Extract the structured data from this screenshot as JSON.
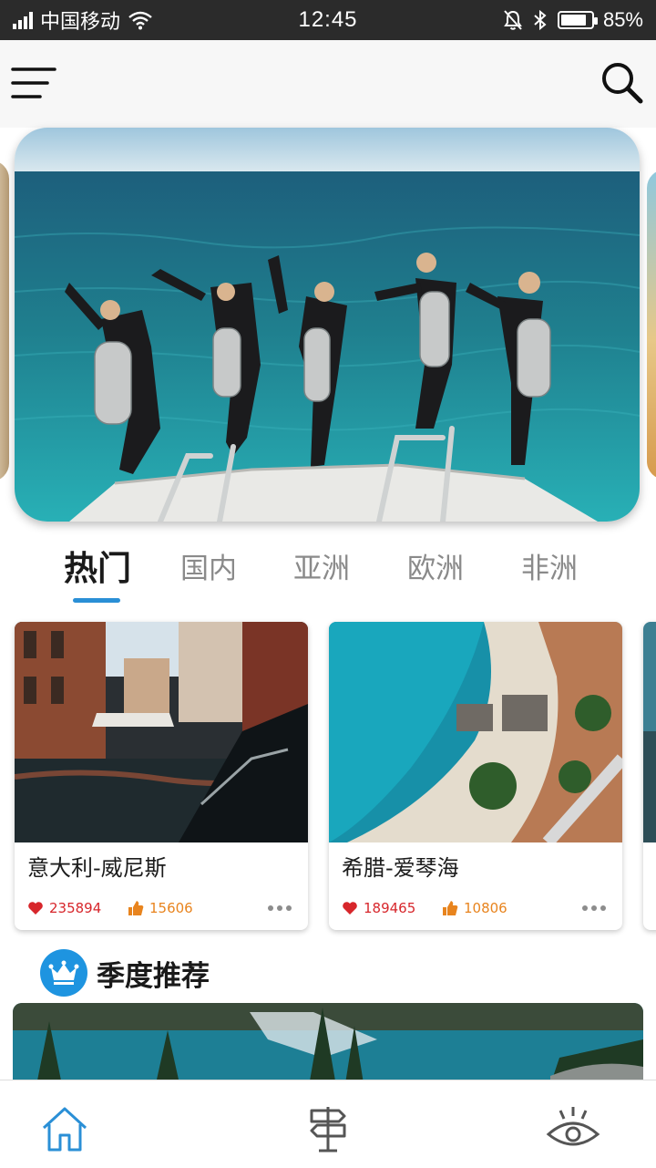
{
  "status_bar": {
    "carrier": "中国移动",
    "time": "12:45",
    "battery_percent": "85%",
    "battery_level": 0.85,
    "icons": [
      "signal-icon",
      "wifi-icon",
      "mute-bell-icon",
      "bluetooth-icon",
      "battery-icon"
    ]
  },
  "header": {
    "menu_icon": "hamburger-menu-icon",
    "search_icon": "search-icon"
  },
  "hero": {
    "image": "scuba-divers-jumping-into-sea-photo"
  },
  "tabs": [
    {
      "label": "热门",
      "active": true
    },
    {
      "label": "国内",
      "active": false
    },
    {
      "label": "亚洲",
      "active": false
    },
    {
      "label": "欧洲",
      "active": false
    },
    {
      "label": "非洲",
      "active": false
    }
  ],
  "destinations": [
    {
      "title": "意大利-威尼斯",
      "likes": "235894",
      "thumbs": "15606",
      "image": "venice-canal-gondola-photo"
    },
    {
      "title": "希腊-爱琴海",
      "likes": "189465",
      "thumbs": "10806",
      "image": "aegean-beach-coast-photo"
    }
  ],
  "season": {
    "title": "季度推荐",
    "icon": "crown-icon",
    "image": "mountain-lake-forest-photo"
  },
  "bottom_nav": {
    "items": [
      {
        "icon": "home-icon",
        "active": true
      },
      {
        "icon": "signpost-icon",
        "active": false
      },
      {
        "icon": "eye-icon",
        "active": false
      }
    ]
  },
  "colors": {
    "accent": "#2a8fd6",
    "likes": "#d7262b",
    "thumbs": "#e8841e",
    "status_bar": "#2b2b2b"
  }
}
